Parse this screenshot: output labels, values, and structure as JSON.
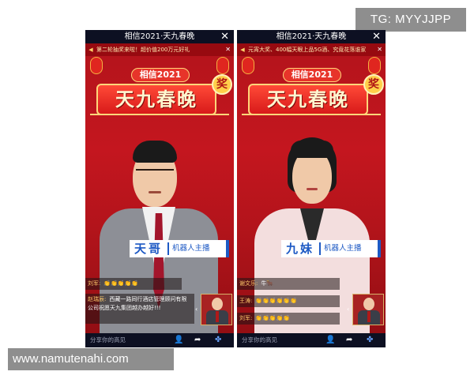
{
  "watermark_top": "TG: MYYJJPP",
  "watermark_bottom": "www.namutenahi.com",
  "left": {
    "title": "相信2021·天九春晚",
    "ticker": "第二轮抽奖来啦！超价值200万元好礼",
    "banner_top": "相信2021",
    "banner_title": "天九春晚",
    "badge": "奖",
    "name": "天哥",
    "role": "机器人主播",
    "comment1_user": "刘军:",
    "comment1_text": "👏👏👏👏👏",
    "comment2_user": "赵瑞辰:",
    "comment2_text": "西藏一路同行酒店管理顾问有限公司祝愿天九集团越办越好!!!",
    "input_placeholder": "分享你的高见"
  },
  "right": {
    "title": "相信2021·天九春晚",
    "ticker": "元宵大奖、400幅天眼上品5G酒、究竟花落谁家",
    "banner_top": "相信2021",
    "banner_title": "天九春晚",
    "badge": "奖",
    "name": "九妹",
    "role": "机器人主播",
    "comment1_user": "谢文乐:",
    "comment1_text": "牛🐂",
    "comment2_user": "王涛:",
    "comment2_text": "👏👏👏👏👏👏",
    "comment3_user": "刘军:",
    "comment3_text": "👏👏👏👏👏",
    "input_placeholder": "分享你的高见"
  },
  "icons": {
    "close": "close-icon",
    "speaker": "speaker-icon",
    "user": "user-icon",
    "share": "share-icon",
    "apps": "apps-icon"
  },
  "colors": {
    "stage_red": "#b3141b",
    "nameplate_blue": "#1d59c4",
    "title_bar": "#0d1022"
  }
}
